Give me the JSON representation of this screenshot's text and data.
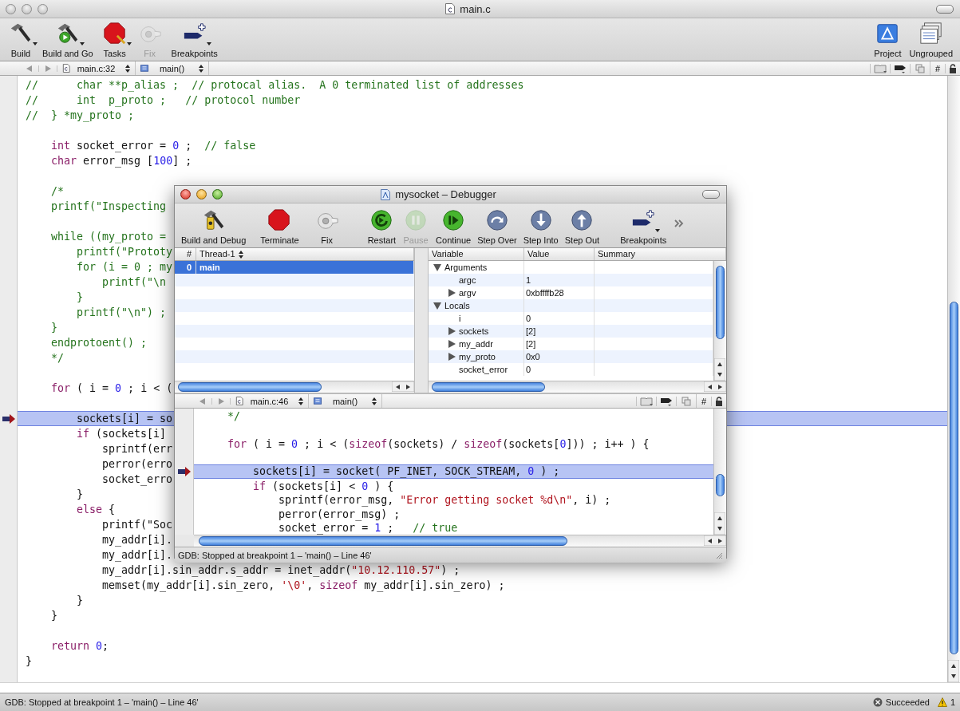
{
  "main_window": {
    "title": "main.c",
    "active": false,
    "toolbar": [
      {
        "kind": "build",
        "label": "Build",
        "menu": true,
        "disabled": false
      },
      {
        "kind": "buildgo",
        "label": "Build and Go",
        "menu": true,
        "disabled": false
      },
      {
        "kind": "tasks",
        "label": "Tasks",
        "menu": true,
        "disabled": false
      },
      {
        "kind": "fix",
        "label": "Fix",
        "menu": false,
        "disabled": true
      },
      {
        "kind": "breakpoints",
        "label": "Breakpoints",
        "menu": true,
        "disabled": false
      }
    ],
    "toolbar_right": [
      {
        "kind": "project",
        "label": "Project",
        "menu": false,
        "disabled": false
      },
      {
        "kind": "ungrouped",
        "label": "Ungrouped",
        "menu": false,
        "disabled": false
      }
    ],
    "navigation": {
      "file": "main.c:32",
      "function": "main()",
      "symbol_menu": "#"
    },
    "editor": {
      "lines": [
        {
          "segments": [
            {
              "kind": "comment",
              "text": "//      char **p_alias ;  // protocal alias.  A 0 terminated list of addresses"
            }
          ],
          "current": false
        },
        {
          "segments": [
            {
              "kind": "comment",
              "text": "//      int  p_proto ;   // protocol number"
            }
          ],
          "current": false
        },
        {
          "segments": [
            {
              "kind": "comment",
              "text": "//  } *my_proto ;"
            }
          ],
          "current": false
        },
        {
          "current": false
        },
        {
          "segments": [
            {
              "kind": "keyword",
              "text": "    int"
            },
            {
              "kind": "plain",
              "text": " socket_error = "
            },
            {
              "kind": "number",
              "text": "0"
            },
            {
              "kind": "plain",
              "text": " ;  "
            },
            {
              "kind": "comment",
              "text": "// false"
            }
          ],
          "current": false
        },
        {
          "segments": [
            {
              "kind": "keyword",
              "text": "    char"
            },
            {
              "kind": "plain",
              "text": " error_msg ["
            },
            {
              "kind": "number",
              "text": "100"
            },
            {
              "kind": "plain",
              "text": "] ;"
            }
          ],
          "current": false
        },
        {
          "current": false
        },
        {
          "segments": [
            {
              "kind": "comment",
              "text": "    /*"
            }
          ],
          "current": false
        },
        {
          "segments": [
            {
              "kind": "comment",
              "text": "    printf(\"Inspecting"
            }
          ],
          "current": false
        },
        {
          "current": false
        },
        {
          "segments": [
            {
              "kind": "comment",
              "text": "    while ((my_proto ="
            }
          ],
          "current": false
        },
        {
          "segments": [
            {
              "kind": "comment",
              "text": "        printf(\"Prototy"
            }
          ],
          "current": false
        },
        {
          "segments": [
            {
              "kind": "comment",
              "text": "        for (i = 0 ; my"
            }
          ],
          "current": false
        },
        {
          "segments": [
            {
              "kind": "comment",
              "text": "            printf(\"\\n"
            }
          ],
          "current": false
        },
        {
          "segments": [
            {
              "kind": "comment",
              "text": "        }"
            }
          ],
          "current": false
        },
        {
          "segments": [
            {
              "kind": "comment",
              "text": "        printf(\"\\n\") ;"
            }
          ],
          "current": false
        },
        {
          "segments": [
            {
              "kind": "comment",
              "text": "    }"
            }
          ],
          "current": false
        },
        {
          "segments": [
            {
              "kind": "comment",
              "text": "    endprotoent() ;"
            }
          ],
          "current": false
        },
        {
          "segments": [
            {
              "kind": "comment",
              "text": "    */"
            }
          ],
          "current": false
        },
        {
          "current": false
        },
        {
          "segments": [
            {
              "kind": "keyword",
              "text": "    for"
            },
            {
              "kind": "plain",
              "text": " ( i = "
            },
            {
              "kind": "number",
              "text": "0"
            },
            {
              "kind": "plain",
              "text": " ; i < ("
            }
          ],
          "current": false
        },
        {
          "current": false
        },
        {
          "segments": [
            {
              "kind": "plain",
              "text": "        sockets[i] = so"
            }
          ],
          "current": true
        },
        {
          "segments": [
            {
              "kind": "keyword",
              "text": "        if"
            },
            {
              "kind": "plain",
              "text": " (sockets[i]"
            }
          ],
          "current": false
        },
        {
          "segments": [
            {
              "kind": "plain",
              "text": "            sprintf(err"
            }
          ],
          "current": false
        },
        {
          "segments": [
            {
              "kind": "plain",
              "text": "            perror(erro"
            }
          ],
          "current": false
        },
        {
          "segments": [
            {
              "kind": "plain",
              "text": "            socket_erro"
            }
          ],
          "current": false
        },
        {
          "segments": [
            {
              "kind": "plain",
              "text": "        }"
            }
          ],
          "current": false
        },
        {
          "segments": [
            {
              "kind": "keyword",
              "text": "        else"
            },
            {
              "kind": "plain",
              "text": " {"
            }
          ],
          "current": false
        },
        {
          "segments": [
            {
              "kind": "plain",
              "text": "            printf(\"Soc"
            }
          ],
          "current": false
        },
        {
          "segments": [
            {
              "kind": "plain",
              "text": "            my_addr[i]."
            }
          ],
          "current": false
        },
        {
          "segments": [
            {
              "kind": "plain",
              "text": "            my_addr[i]."
            }
          ],
          "current": false
        },
        {
          "segments": [
            {
              "kind": "plain",
              "text": "            my_addr[i].sin_addr.s_addr = inet_addr("
            },
            {
              "kind": "string",
              "text": "\"10.12.110.57\""
            },
            {
              "kind": "plain",
              "text": ") ;"
            }
          ],
          "current": false
        },
        {
          "segments": [
            {
              "kind": "plain",
              "text": "            memset(my_addr[i].sin_zero, "
            },
            {
              "kind": "string",
              "text": "'\\0'"
            },
            {
              "kind": "plain",
              "text": ", "
            },
            {
              "kind": "keyword",
              "text": "sizeof"
            },
            {
              "kind": "plain",
              "text": " my_addr[i].sin_zero) ;"
            }
          ],
          "current": false
        },
        {
          "segments": [
            {
              "kind": "plain",
              "text": "        }"
            }
          ],
          "current": false
        },
        {
          "segments": [
            {
              "kind": "plain",
              "text": "    }"
            }
          ],
          "current": false
        },
        {
          "current": false
        },
        {
          "segments": [
            {
              "kind": "keyword",
              "text": "    return "
            },
            {
              "kind": "number",
              "text": "0"
            },
            {
              "kind": "plain",
              "text": ";"
            }
          ],
          "current": false
        },
        {
          "segments": [
            {
              "kind": "plain",
              "text": "}"
            }
          ],
          "current": false
        }
      ]
    },
    "status": "GDB: Stopped at breakpoint 1 – 'main() – Line 46'",
    "build_result": "Succeeded",
    "warnings": "1"
  },
  "debugger_window": {
    "title": "mysocket – Debugger",
    "active": true,
    "toolbar": [
      {
        "kind": "builddebug",
        "label": "Build and Debug",
        "menu": false,
        "disabled": false
      },
      {
        "kind": "terminate",
        "label": "Terminate",
        "menu": false,
        "disabled": false
      },
      {
        "kind": "fix",
        "label": "Fix",
        "menu": false,
        "disabled": false
      },
      {
        "kind": "restart",
        "label": "Restart",
        "menu": false,
        "disabled": false
      },
      {
        "kind": "pause",
        "label": "Pause",
        "menu": false,
        "disabled": true
      },
      {
        "kind": "continue",
        "label": "Continue",
        "menu": false,
        "disabled": false
      },
      {
        "kind": "stepover",
        "label": "Step Over",
        "menu": false,
        "disabled": false
      },
      {
        "kind": "stepinto",
        "label": "Step Into",
        "menu": false,
        "disabled": false
      },
      {
        "kind": "stepout",
        "label": "Step Out",
        "menu": false,
        "disabled": false
      },
      {
        "kind": "breakpoints",
        "label": "Breakpoints",
        "menu": true,
        "disabled": false
      }
    ],
    "threads": {
      "columns": [
        "#",
        "Thread-1"
      ],
      "rows": [
        {
          "number": "0",
          "name": "main",
          "selected": true
        }
      ]
    },
    "variables": {
      "columns": [
        "Variable",
        "Value",
        "Summary"
      ],
      "rows": [
        {
          "name": "Arguments",
          "expanded": true,
          "children": [
            {
              "name": "argc",
              "value": "1"
            },
            {
              "name": "argv",
              "value": "0xbffffb28",
              "expanded": false
            }
          ]
        },
        {
          "name": "Locals",
          "expanded": true,
          "children": [
            {
              "name": "i",
              "value": "0"
            },
            {
              "name": "sockets",
              "value": "[2]",
              "expanded": false
            },
            {
              "name": "my_addr",
              "value": "[2]",
              "expanded": false
            },
            {
              "name": "my_proto",
              "value": "0x0",
              "expanded": false
            },
            {
              "name": "socket_error",
              "value": "0"
            }
          ]
        }
      ]
    },
    "navigation": {
      "file": "main.c:46",
      "function": "main()",
      "symbol_menu": "#"
    },
    "editor": {
      "lines": [
        {
          "segments": [
            {
              "kind": "comment",
              "text": "    */"
            }
          ],
          "current": false
        },
        {
          "current": false
        },
        {
          "segments": [
            {
              "kind": "keyword",
              "text": "    for"
            },
            {
              "kind": "plain",
              "text": " ( i = "
            },
            {
              "kind": "number",
              "text": "0"
            },
            {
              "kind": "plain",
              "text": " ; i < ("
            },
            {
              "kind": "keyword",
              "text": "sizeof"
            },
            {
              "kind": "plain",
              "text": "(sockets) / "
            },
            {
              "kind": "keyword",
              "text": "sizeof"
            },
            {
              "kind": "plain",
              "text": "(sockets["
            },
            {
              "kind": "number",
              "text": "0"
            },
            {
              "kind": "plain",
              "text": "])) ; i++ ) {"
            }
          ],
          "current": false
        },
        {
          "current": false
        },
        {
          "segments": [
            {
              "kind": "plain",
              "text": "        sockets[i] = socket( PF_INET, SOCK_STREAM, "
            },
            {
              "kind": "number",
              "text": "0"
            },
            {
              "kind": "plain",
              "text": " ) ;"
            }
          ],
          "current": true
        },
        {
          "segments": [
            {
              "kind": "keyword",
              "text": "        if"
            },
            {
              "kind": "plain",
              "text": " (sockets[i] < "
            },
            {
              "kind": "number",
              "text": "0"
            },
            {
              "kind": "plain",
              "text": " ) {"
            }
          ],
          "current": false
        },
        {
          "segments": [
            {
              "kind": "plain",
              "text": "            sprintf(error_msg, "
            },
            {
              "kind": "string",
              "text": "\"Error getting socket %d\\n\""
            },
            {
              "kind": "plain",
              "text": ", i) ;"
            }
          ],
          "current": false
        },
        {
          "segments": [
            {
              "kind": "plain",
              "text": "            perror(error_msg) ;"
            }
          ],
          "current": false
        },
        {
          "segments": [
            {
              "kind": "plain",
              "text": "            socket_error = "
            },
            {
              "kind": "number",
              "text": "1"
            },
            {
              "kind": "plain",
              "text": " ;   "
            },
            {
              "kind": "comment",
              "text": "// true"
            }
          ],
          "current": false
        }
      ]
    },
    "status": "GDB: Stopped at breakpoint 1 – 'main() – Line 46'"
  }
}
